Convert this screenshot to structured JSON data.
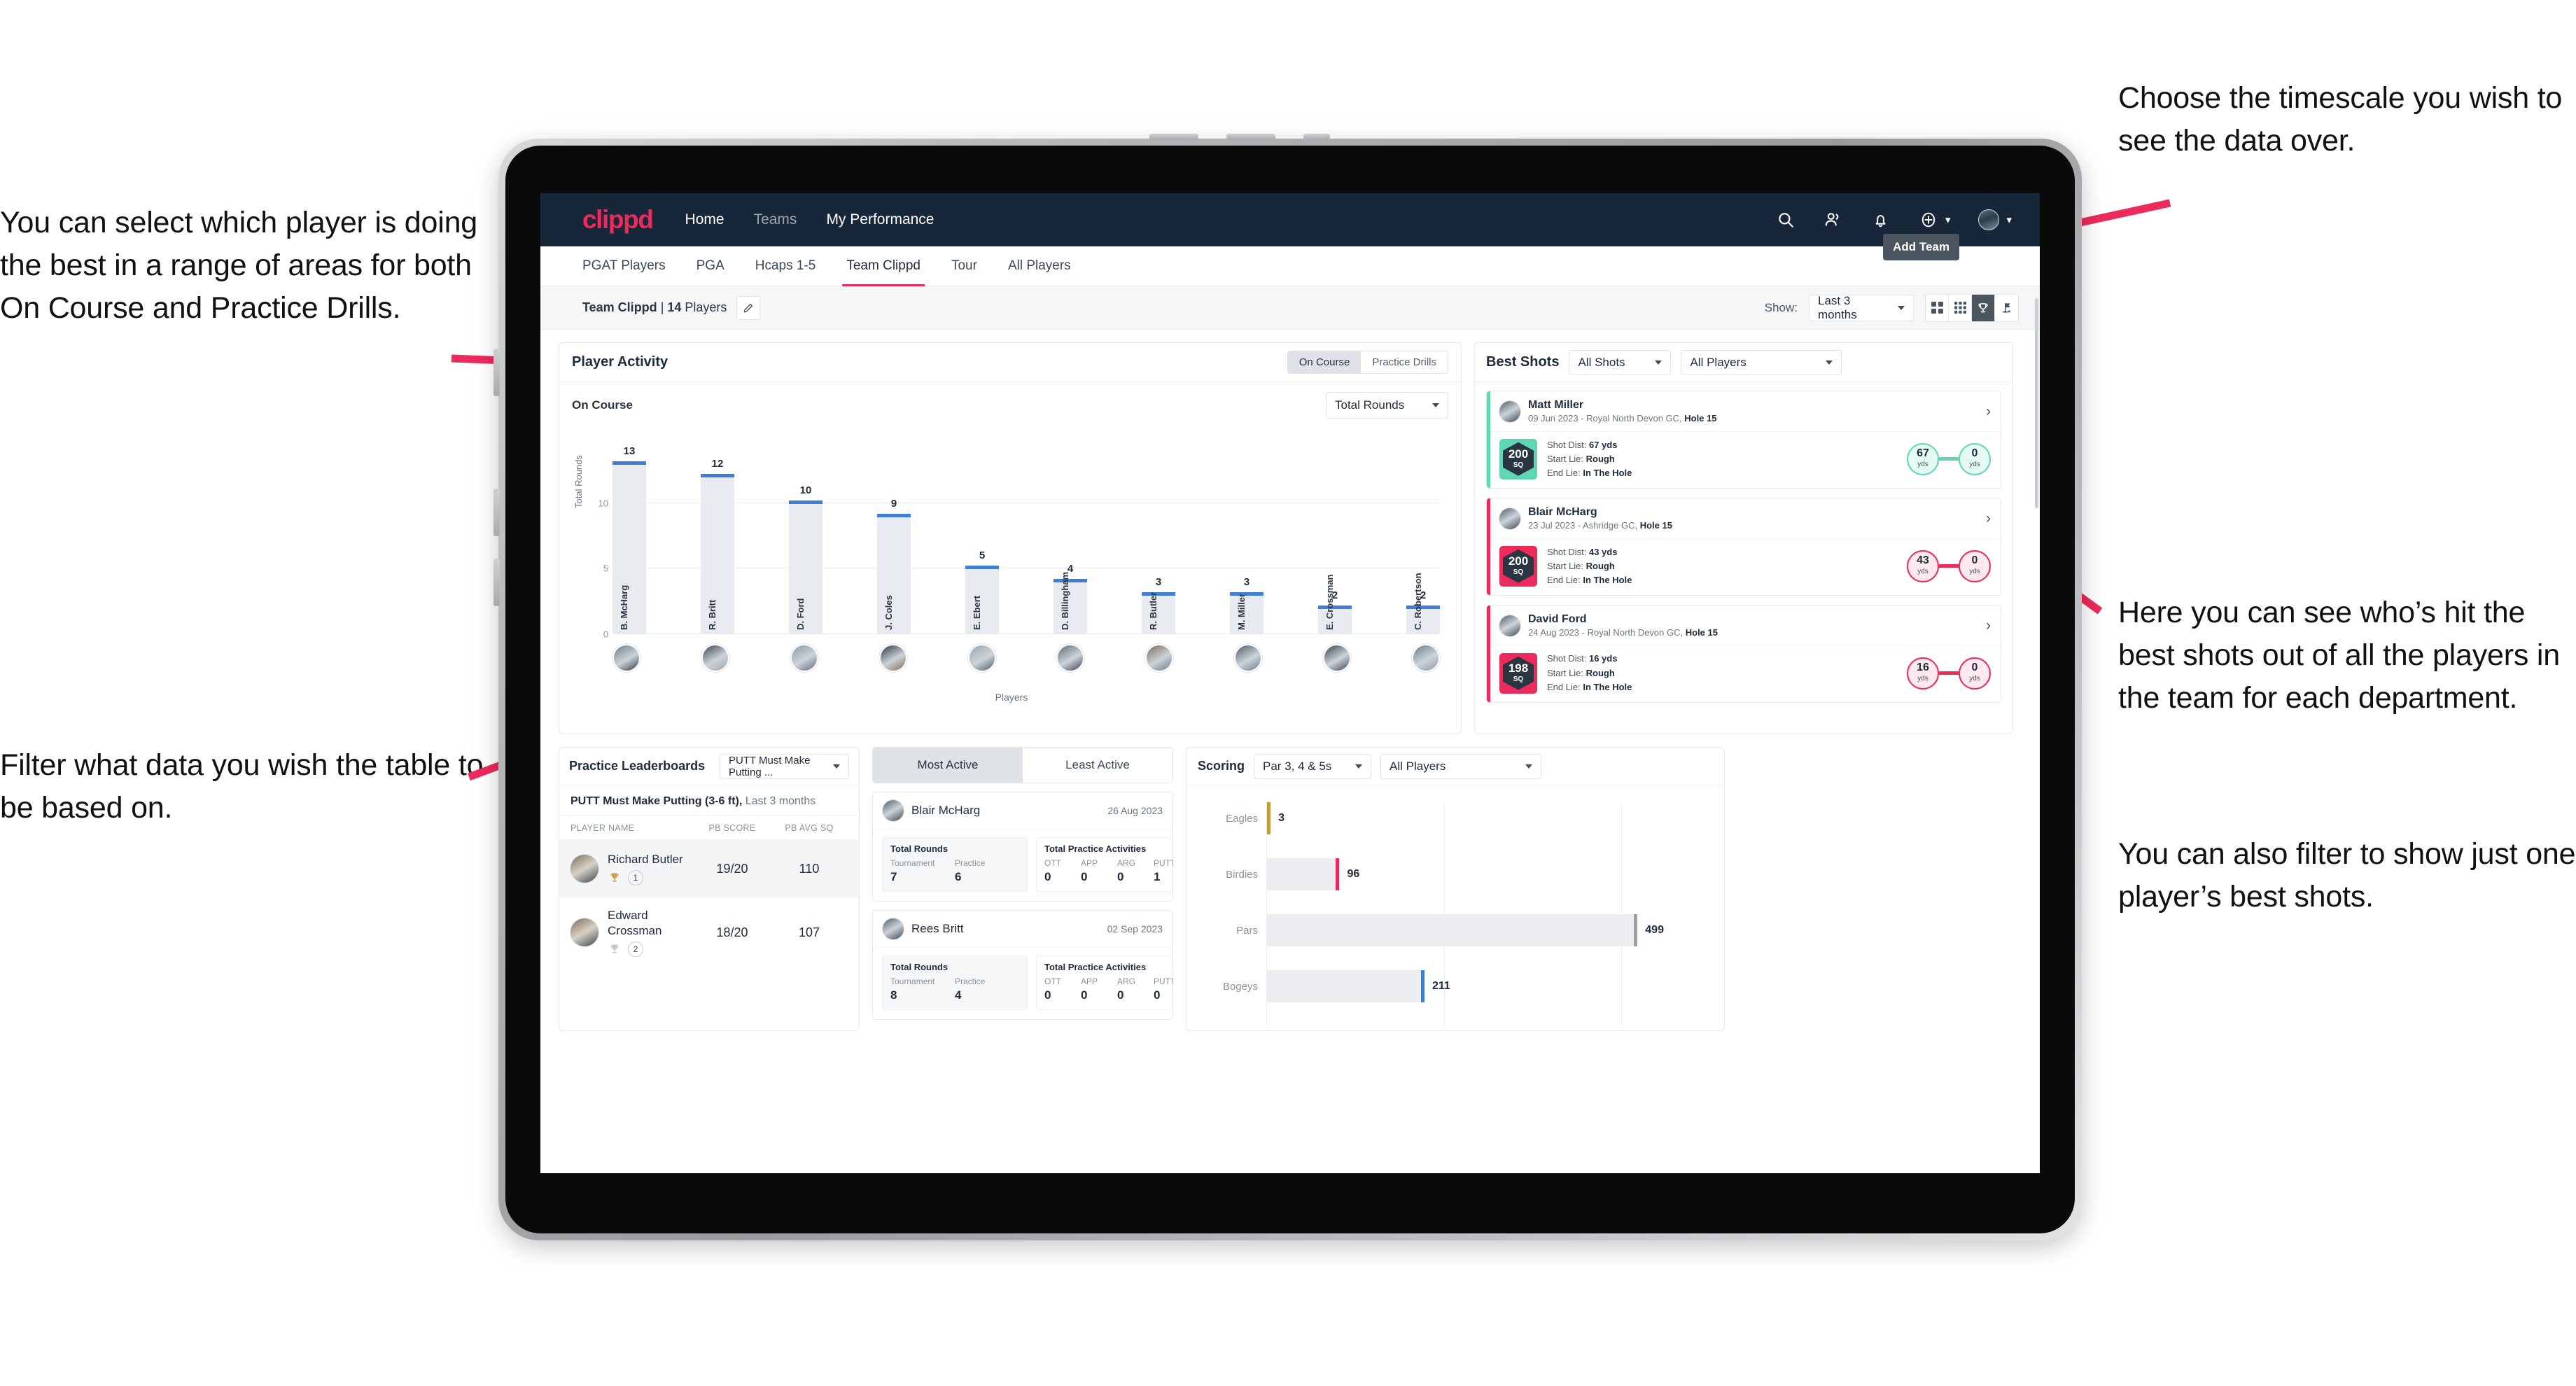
{
  "annotations": {
    "left_top": "You can select which player is doing the best in a range of areas for both On Course and Practice Drills.",
    "left_bottom": "Filter what data you wish the table to be based on.",
    "right_top": "Choose the timescale you wish to see the data over.",
    "right_middle": "Here you can see who’s hit the best shots out of all the players in the team for each department.",
    "right_bottom": "You can also filter to show just one player’s best shots."
  },
  "topnav": {
    "logo": "clippd",
    "links": [
      {
        "label": "Home",
        "active": true
      },
      {
        "label": "Teams",
        "active": false
      },
      {
        "label": "My Performance",
        "active": true
      }
    ],
    "icons": [
      "search-icon",
      "people-icon",
      "bell-icon",
      "plus-circle-icon",
      "avatar"
    ]
  },
  "tabs": [
    {
      "label": "PGAT Players",
      "active": false
    },
    {
      "label": "PGA",
      "active": false
    },
    {
      "label": "Hcaps 1-5",
      "active": false
    },
    {
      "label": "Team Clippd",
      "active": true
    },
    {
      "label": "Tour",
      "active": false
    },
    {
      "label": "All Players",
      "active": false
    }
  ],
  "tooltip": {
    "add_team": "Add Team"
  },
  "subbar": {
    "team_name": "Team Clippd",
    "separator": " | ",
    "player_count": "14",
    "players_word": " Players",
    "edit_icon": "pencil-icon",
    "show_label": "Show:",
    "timescale": "Last 3 months",
    "view_toggles": [
      {
        "icon": "grid-2x2-icon",
        "active": false
      },
      {
        "icon": "grid-3x3-icon",
        "active": false
      },
      {
        "icon": "trophy-icon",
        "active": true
      },
      {
        "icon": "golf-flag-icon",
        "active": false
      }
    ]
  },
  "player_activity": {
    "title": "Player Activity",
    "segments": [
      {
        "label": "On Course",
        "active": true
      },
      {
        "label": "Practice Drills",
        "active": false
      }
    ],
    "sub_label": "On Course",
    "metric_select": "Total Rounds"
  },
  "chart_data": [
    {
      "type": "bar",
      "title": "Player Activity – On Course",
      "xlabel": "Players",
      "ylabel": "Total Rounds",
      "categories": [
        "B. McHarg",
        "R. Britt",
        "D. Ford",
        "J. Coles",
        "E. Ebert",
        "D. Billingham",
        "R. Butler",
        "M. Miller",
        "E. Crossman",
        "C. Robertson"
      ],
      "values": [
        13,
        12,
        10,
        9,
        5,
        4,
        3,
        3,
        2,
        2
      ],
      "ylim": [
        0,
        14
      ],
      "yticks": [
        0,
        5,
        10
      ],
      "grid": true,
      "bar_color": "#e7eaee",
      "cap_color": "#3d7fd6",
      "legend": "none"
    },
    {
      "type": "bar",
      "orientation": "horizontal",
      "title": "Scoring",
      "xlabel": "",
      "ylabel": "",
      "categories": [
        "Eagles",
        "Birdies",
        "Pars",
        "Bogeys"
      ],
      "values": [
        3,
        96,
        499,
        211
      ],
      "cap_colors": [
        "#c79a3f",
        "#ec2a5b",
        "#9aa0a6",
        "#3d7fd6"
      ],
      "xlim": [
        0,
        600
      ],
      "grid": true,
      "legend": "none"
    }
  ],
  "best_shots": {
    "title": "Best Shots",
    "shot_filter": "All Shots",
    "player_filter": "All Players",
    "items": [
      {
        "player": "Matt Miller",
        "meta_date": "09 Jun 2023 - Royal North Devon GC, ",
        "meta_hole": "Hole 15",
        "score": "200",
        "score_unit": "SQ",
        "accent": "#5fd6b4",
        "shot_dist_label": "Shot Dist: ",
        "shot_dist": "67 yds",
        "start_lie_label": "Start Lie: ",
        "start_lie": "Rough",
        "end_lie_label": "End Lie: ",
        "end_lie": "In The Hole",
        "from_value": "67",
        "from_unit": "yds",
        "to_value": "0",
        "to_unit": "yds"
      },
      {
        "player": "Blair McHarg",
        "meta_date": "23 Jul 2023 - Ashridge GC, ",
        "meta_hole": "Hole 15",
        "score": "200",
        "score_unit": "SQ",
        "accent": "#ec2a5b",
        "shot_dist_label": "Shot Dist: ",
        "shot_dist": "43 yds",
        "start_lie_label": "Start Lie: ",
        "start_lie": "Rough",
        "end_lie_label": "End Lie: ",
        "end_lie": "In The Hole",
        "from_value": "43",
        "from_unit": "yds",
        "to_value": "0",
        "to_unit": "yds"
      },
      {
        "player": "David Ford",
        "meta_date": "24 Aug 2023 - Royal North Devon GC, ",
        "meta_hole": "Hole 15",
        "score": "198",
        "score_unit": "SQ",
        "accent": "#ec2a5b",
        "shot_dist_label": "Shot Dist: ",
        "shot_dist": "16 yds",
        "start_lie_label": "Start Lie: ",
        "start_lie": "Rough",
        "end_lie_label": "End Lie: ",
        "end_lie": "In The Hole",
        "from_value": "16",
        "from_unit": "yds",
        "to_value": "0",
        "to_unit": "yds"
      }
    ]
  },
  "practice_leaderboards": {
    "title": "Practice Leaderboards",
    "drill_select": "PUTT Must Make Putting ...",
    "subtitle_bold": "PUTT Must Make Putting (3-6 ft),",
    "subtitle_rest": " Last 3 months",
    "columns": [
      "PLAYER NAME",
      "PB SCORE",
      "PB AVG SQ"
    ],
    "rows": [
      {
        "name": "Richard Butler",
        "rank": "1",
        "trophy": "gold",
        "pb_score": "19/20",
        "pb_avg_sq": "110",
        "highlight": true
      },
      {
        "name": "Edward Crossman",
        "rank": "2",
        "trophy": "silver",
        "pb_score": "18/20",
        "pb_avg_sq": "107",
        "highlight": false
      }
    ]
  },
  "activity": {
    "tabs": [
      {
        "label": "Most Active",
        "active": true
      },
      {
        "label": "Least Active",
        "active": false
      }
    ],
    "items": [
      {
        "name": "Blair McHarg",
        "date": "26 Aug 2023",
        "rounds_title": "Total Rounds",
        "rounds_keys": [
          "Tournament",
          "Practice"
        ],
        "rounds_values": [
          "7",
          "6"
        ],
        "practice_title": "Total Practice Activities",
        "practice_keys": [
          "OTT",
          "APP",
          "ARG",
          "PUTT"
        ],
        "practice_values": [
          "0",
          "0",
          "0",
          "1"
        ]
      },
      {
        "name": "Rees Britt",
        "date": "02 Sep 2023",
        "rounds_title": "Total Rounds",
        "rounds_keys": [
          "Tournament",
          "Practice"
        ],
        "rounds_values": [
          "8",
          "4"
        ],
        "practice_title": "Total Practice Activities",
        "practice_keys": [
          "OTT",
          "APP",
          "ARG",
          "PUTT"
        ],
        "practice_values": [
          "0",
          "0",
          "0",
          "0"
        ]
      }
    ]
  },
  "scoring": {
    "title": "Scoring",
    "par_filter": "Par 3, 4 & 5s",
    "player_filter": "All Players"
  }
}
